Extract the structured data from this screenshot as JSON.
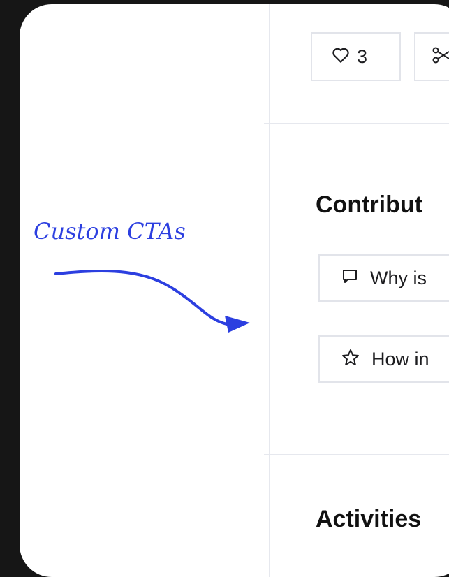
{
  "toolbar": {
    "like_count": "3"
  },
  "sections": {
    "contribute_title": "Contribut",
    "activities_title": "Activities"
  },
  "ctas": [
    {
      "label": "Why is",
      "icon": "comment-icon"
    },
    {
      "label": "How in",
      "icon": "star-icon"
    }
  ],
  "annotation": {
    "text": "Custom CTAs",
    "color": "#2c3fe0"
  }
}
